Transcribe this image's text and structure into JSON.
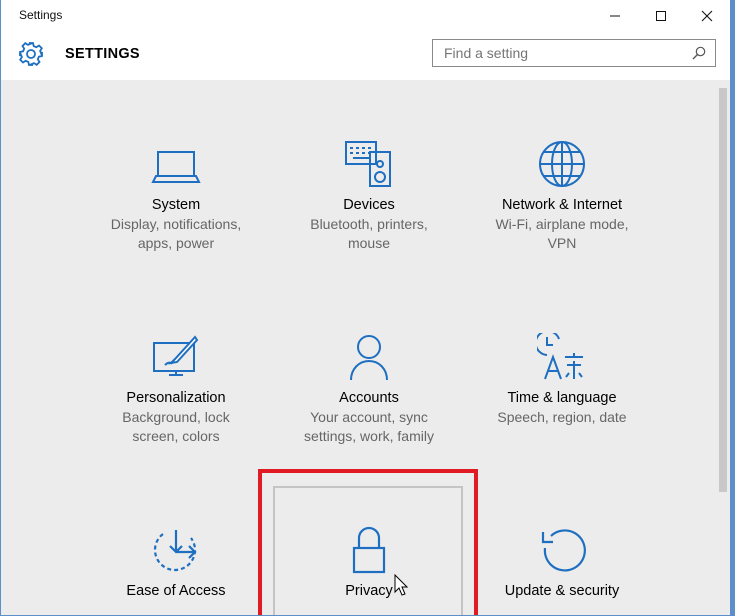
{
  "window": {
    "title": "Settings",
    "controls": {
      "minimize": "─",
      "maximize": "☐",
      "close": "✕"
    }
  },
  "header": {
    "heading": "SETTINGS",
    "icon": "gear-icon",
    "search": {
      "placeholder": "Find a setting",
      "value": "",
      "icon": "search-icon"
    }
  },
  "tiles": [
    {
      "id": "system",
      "icon": "laptop-icon",
      "label": "System",
      "desc1": "Display, notifications,",
      "desc2": "apps, power"
    },
    {
      "id": "devices",
      "icon": "keyboard-speaker-icon",
      "label": "Devices",
      "desc1": "Bluetooth, printers,",
      "desc2": "mouse"
    },
    {
      "id": "network",
      "icon": "globe-icon",
      "label": "Network & Internet",
      "desc1": "Wi-Fi, airplane mode,",
      "desc2": "VPN"
    },
    {
      "id": "personalization",
      "icon": "paintbrush-monitor-icon",
      "label": "Personalization",
      "desc1": "Background, lock",
      "desc2": "screen, colors"
    },
    {
      "id": "accounts",
      "icon": "person-icon",
      "label": "Accounts",
      "desc1": "Your account, sync",
      "desc2": "settings, work, family"
    },
    {
      "id": "time",
      "icon": "clock-language-icon",
      "label": "Time & language",
      "desc1": "Speech, region, date",
      "desc2": ""
    },
    {
      "id": "ease",
      "icon": "ease-of-access-icon",
      "label": "Ease of Access",
      "desc1": "",
      "desc2": ""
    },
    {
      "id": "privacy",
      "icon": "lock-icon",
      "label": "Privacy",
      "desc1": "",
      "desc2": ""
    },
    {
      "id": "update",
      "icon": "refresh-icon",
      "label": "Update & security",
      "desc1": "",
      "desc2": ""
    }
  ],
  "colors": {
    "accent": "#1e6fc1",
    "highlight": "#e01b24",
    "background": "#ececec"
  }
}
